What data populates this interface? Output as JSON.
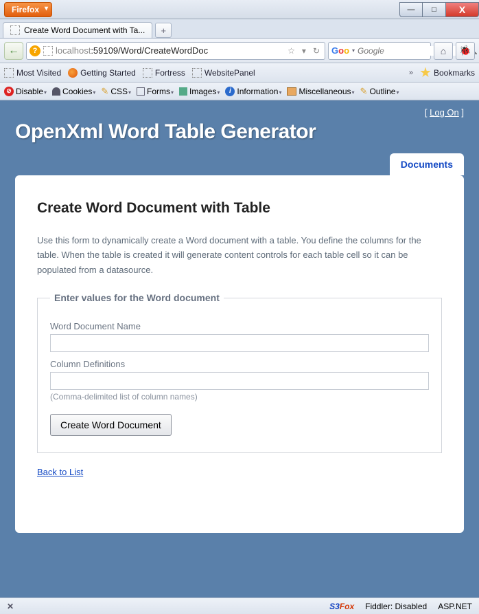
{
  "window": {
    "browser_button": "Firefox",
    "min": "—",
    "max": "□",
    "close": "X"
  },
  "tab": {
    "title": "Create Word Document with Ta...",
    "new_tab": "+"
  },
  "nav": {
    "back": "←",
    "url_host": "localhost",
    "url_port_path": ":59109/Word/CreateWordDoc",
    "star": "☆",
    "dropdown": "▾",
    "reload": "↻",
    "search_placeholder": "Google",
    "search_mag": "🔍",
    "home": "⌂",
    "bug": "🐞"
  },
  "bookmarks": {
    "items": [
      "Most Visited",
      "Getting Started",
      "Fortress",
      "WebsitePanel"
    ],
    "label": "Bookmarks"
  },
  "devtools": {
    "disable": "Disable",
    "cookies": "Cookies",
    "css": "CSS",
    "forms": "Forms",
    "images": "Images",
    "information": "Information",
    "miscellaneous": "Miscellaneous",
    "outline": "Outline"
  },
  "page": {
    "logon_prefix": "[ ",
    "logon_link": "Log On",
    "logon_suffix": " ]",
    "site_title": "OpenXml Word Table Generator",
    "active_tab": "Documents",
    "heading": "Create Word Document with Table",
    "intro": "Use this form to dynamically create a Word document with a table. You define the columns for the table. When the table is created it will generate content controls for each table cell so it can be populated from a datasource.",
    "legend": "Enter values for the Word document",
    "field1_label": "Word Document Name",
    "field1_value": "",
    "field2_label": "Column Definitions",
    "field2_value": "",
    "field2_hint": "(Comma-delimited list of column names)",
    "submit": "Create Word Document",
    "back_link": "Back to List"
  },
  "status": {
    "s3fox_s3": "S3",
    "s3fox_fox": "Fox",
    "fiddler": "Fiddler: Disabled",
    "aspnet": "ASP.NET"
  }
}
